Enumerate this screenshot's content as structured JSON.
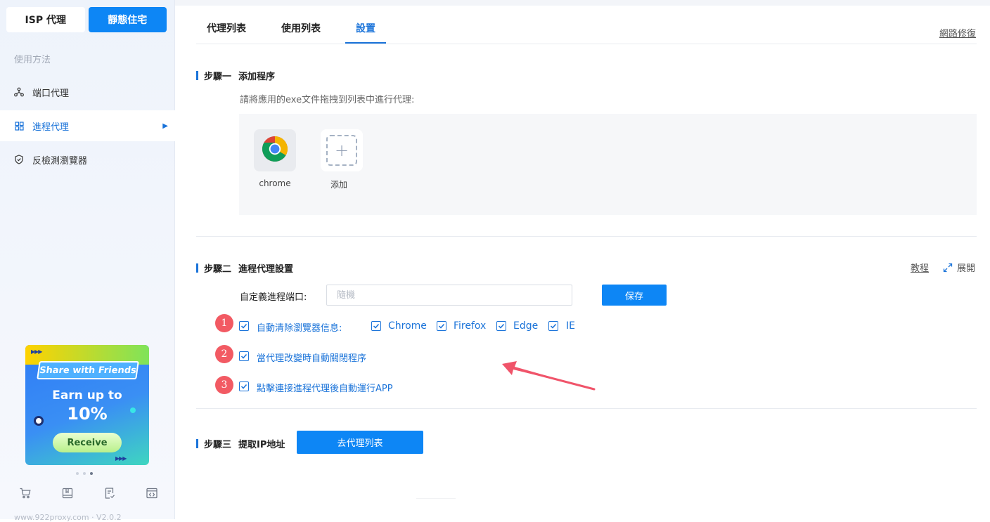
{
  "sidebar": {
    "top_tabs": [
      {
        "label": "ISP 代理"
      },
      {
        "label": "靜態住宅"
      }
    ],
    "section_title": "使用方法",
    "items": [
      {
        "label": "端口代理",
        "icon": "network-icon"
      },
      {
        "label": "進程代理",
        "icon": "apps-grid-icon"
      },
      {
        "label": "反檢測瀏覽器",
        "icon": "shield-icon"
      }
    ],
    "promo": {
      "share": "Share with Friends",
      "earn": "Earn up to",
      "percent": "10%",
      "receive": "Receive"
    },
    "bottom_icons": [
      "cart-icon",
      "book-icon",
      "document-check-icon",
      "code-window-icon"
    ],
    "footer": "www.922proxy.com · V2.0.2"
  },
  "main": {
    "tabs": [
      {
        "label": "代理列表"
      },
      {
        "label": "使用列表"
      },
      {
        "label": "設置"
      }
    ],
    "repair_link": "網路修復",
    "step1": {
      "num": "步驟一",
      "title": "添加程序",
      "hint": "請將應用的exe文件拖拽到列表中進行代理:",
      "apps": [
        {
          "label": "chrome"
        },
        {
          "label": "添加"
        }
      ]
    },
    "step2": {
      "num": "步驟二",
      "title": "進程代理設置",
      "tutorial": "教程",
      "expand": "展開",
      "port_label": "自定義進程端口:",
      "port_placeholder": "隨機",
      "save": "保存",
      "options": [
        {
          "badge": "1",
          "label": "自動清除瀏覽器信息:",
          "checked": true
        },
        {
          "badge": "2",
          "label": "當代理改變時自動關閉程序",
          "checked": true
        },
        {
          "badge": "3",
          "label": "點擊連接進程代理後自動運行APP",
          "checked": true
        }
      ],
      "browsers": [
        {
          "label": "Chrome",
          "checked": true
        },
        {
          "label": "Firefox",
          "checked": true
        },
        {
          "label": "Edge",
          "checked": true
        },
        {
          "label": "IE",
          "checked": true
        }
      ]
    },
    "step3": {
      "num": "步驟三",
      "title": "提取IP地址",
      "button": "去代理列表"
    }
  },
  "colors": {
    "accent": "#0d86f5",
    "badge": "#f25a63",
    "annotation_arrow": "#f0546a"
  }
}
